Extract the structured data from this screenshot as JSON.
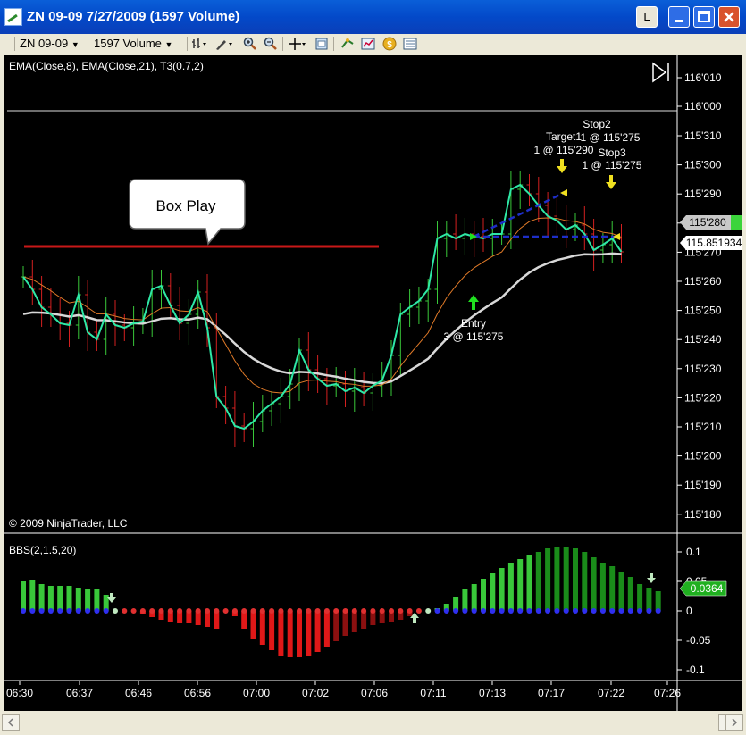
{
  "window": {
    "title": "ZN 09-09  7/27/2009 (1597 Volume)",
    "buttons": {
      "l": "L",
      "minimize": "_",
      "maximize": "□",
      "close": "✕"
    }
  },
  "toolbar": {
    "instrument": "ZN 09-09",
    "interval": "1597 Volume",
    "icons": [
      "bar-type-icon",
      "drawing-tool-icon",
      "zoom-in-icon",
      "zoom-out-icon",
      "crosshair-icon",
      "properties-icon",
      "strategies-icon",
      "indicators-icon",
      "ninja-score-icon",
      "data-box-icon"
    ]
  },
  "price_panel": {
    "indicator_label": "EMA(Close,8), EMA(Close,21), T3(0.7,2)",
    "copyright": "© 2009 NinjaTrader, LLC",
    "callout": "Box Play",
    "price_marker": "115'280",
    "t3_marker": "115.851934",
    "y_ticks": [
      "116'010",
      "116'000",
      "115'310",
      "115'300",
      "115'290",
      "115'280",
      "115'270",
      "115'260",
      "115'250",
      "115'240",
      "115'230",
      "115'220",
      "115'210",
      "115'200",
      "115'190",
      "115'180"
    ],
    "annotations": {
      "target_label": "Target1",
      "target_qty": "1 @ 115'290",
      "stop2_label": "Stop2",
      "stop2_qty": "1 @ 115'275",
      "stop3_label": "Stop3",
      "stop3_qty": "1 @ 115'275",
      "entry_label": "Entry",
      "entry_qty": "3 @ 115'275"
    },
    "colors": {
      "ema8": "#2ee8a6",
      "ema21": "#e07a28",
      "t3": "#d8d8d8",
      "bar_up": "#39c83a",
      "bar_down": "#d42020",
      "box_line": "#c81818",
      "target_box": "#1e2ec8"
    }
  },
  "bbs_panel": {
    "label": "BBS(2,1.5,20)",
    "y_ticks": [
      "0.1",
      "0.05",
      "0",
      "-0.05",
      "-0.1"
    ],
    "value_marker": "0.0364"
  },
  "x_axis": {
    "ticks": [
      "06:30",
      "06:37",
      "06:46",
      "06:56",
      "07:00",
      "07:02",
      "07:06",
      "07:11",
      "07:13",
      "07:17",
      "07:22",
      "07:26"
    ]
  }
}
